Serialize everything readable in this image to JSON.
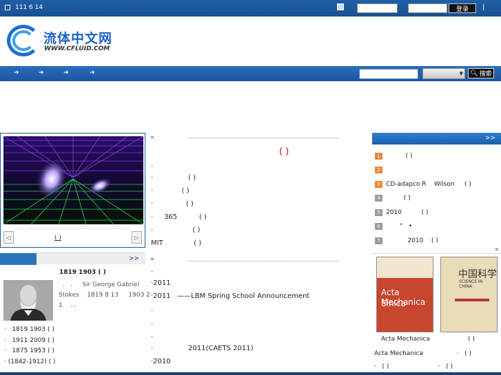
{
  "topbar": {
    "date": "111 6 14",
    "username_placeholder": "",
    "password_placeholder": "",
    "login_label": "登录",
    "separator": "|"
  },
  "logo": {
    "cn": "流体中文网",
    "en": "WWW.CFLUID.COM"
  },
  "nav": {
    "arrows": [
      "➜",
      "➜",
      "➜",
      "➜"
    ],
    "search_placeholder": "",
    "select_value": "",
    "search_label": "搜索"
  },
  "slider": {
    "caption": "( )",
    "prev": "◁",
    "next": "▷"
  },
  "col1": {
    "more": ">>",
    "person_title": "1819  1903  ( )",
    "bio_lines": [
      "  .   .     Sir George Gabriel",
      "Stokes    1819 8 13     1903 2",
      "1    ..."
    ],
    "items": [
      "1819 1903 ( )",
      "1911 2009 ( )",
      "1875 1953 ( )",
      "(1842-1912) ( )"
    ]
  },
  "col2": {
    "headline": "( )",
    "news_block1": [
      ".",
      "·                ( )",
      "·             ( )",
      "·               ( )",
      "·     365          ( )",
      "·                  ( )",
      "MIT              ( )"
    ],
    "news_block2": [
      ".",
      "·2011",
      "·2011   ——LBM Spring School Announcement",
      ".",
      ".",
      ".",
      "·                2011(CAETS 2011)",
      "·2010"
    ]
  },
  "col3": {
    "more": ">>",
    "ranking": [
      {
        "rank": "1",
        "text": "          ( )"
      },
      {
        "rank": "2",
        "text": ""
      },
      {
        "rank": "3",
        "text": "CD-adapco R    Wilson     ( )"
      },
      {
        "rank": "4",
        "text": "         ( )"
      },
      {
        "rank": "5",
        "text": "2010          ( )"
      },
      {
        "rank": "6",
        "text": "       \"   •"
      },
      {
        "rank": "7",
        "text": "           2010    ( )"
      }
    ],
    "journals": {
      "left_title": "Acta Mechanica",
      "left_sub": "Sinica",
      "right_title": "中国科学",
      "right_sub": "SCIENCE IN CHINA",
      "caption_left": "Acta Mechanica",
      "caption_right": "( )"
    },
    "extra": [
      "Acta Mechanica                 ·   ( )",
      "·   ( )                         ·   ( )"
    ]
  },
  "colors": {
    "brand_blue": "#1a57a0",
    "rank_hot": "#e8873b",
    "rank_cold": "#9a9a9a",
    "headline_red": "#cc0000"
  }
}
